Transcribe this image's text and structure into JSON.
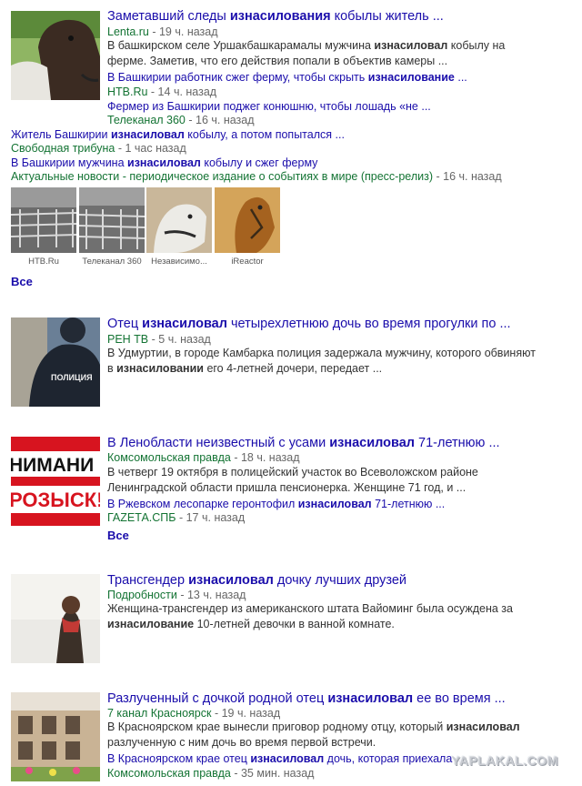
{
  "r1": {
    "title": [
      "Заметавший следы ",
      "изнасилования",
      " кобылы житель ..."
    ],
    "source": "Lenta.ru",
    "time": " - 19 ч. назад",
    "snippet1": [
      "В башкирском селе Уршакбашкарамалы мужчина ",
      "изнасиловал",
      " кобылу на"
    ],
    "snippet2": "ферме. Заметив, что его действия попали в объектив камеры ...",
    "rel1": {
      "title": [
        "В Башкирии работник сжег ферму, чтобы скрыть ",
        "изнасилование",
        " ..."
      ],
      "source": "НТВ.Ru",
      "time": " - 14 ч. назад"
    },
    "rel2": {
      "title": [
        "Фермер из Башкирии поджег конюшню, чтобы лошадь «не ..."
      ],
      "source": "Телеканал 360",
      "time": " - 16 ч. назад"
    },
    "rel3": {
      "title": [
        "Житель Башкирии ",
        "изнасиловал",
        " кобылу, а потом попытался ..."
      ],
      "source": "Свободная трибуна",
      "time": " - 1 час назад"
    },
    "rel4": {
      "title": [
        "В Башкирии мужчина ",
        "изнасиловал",
        " кобылу и сжег ферму"
      ],
      "source": "Актуальные новости - периодическое издание о событиях в мире (пресс-релиз)",
      "time": " - 16 ч. назад"
    },
    "gallery": [
      "HTB.Ru",
      "Телеканал 360",
      "Независимо...",
      "iReactor"
    ],
    "all": "Все"
  },
  "r2": {
    "title": [
      "Отец ",
      "изнасиловал",
      " четырехлетнюю дочь во время прогулки по ..."
    ],
    "source": "РЕН ТВ",
    "time": " - 5 ч. назад",
    "snippet1": [
      "В Удмуртии, в городе Камбарка полиция задержала мужчину, которого обвиняют"
    ],
    "snippet2": [
      "в ",
      "изнасиловании",
      " его 4-летней дочери, передает ..."
    ],
    "thumb_text": "ПОЛИЦИЯ"
  },
  "r3": {
    "title": [
      "В Ленобласти неизвестный с усами ",
      "изнасиловал",
      " 71-летнюю ..."
    ],
    "source": "Комсомольская правда",
    "time": " - 18 ч. назад",
    "snippet1": "В четверг 19 октября в полицейский участок во Всеволожском районе",
    "snippet2": "Ленинградской области пришла пенсионерка. Женщине 71 год, и ...",
    "rel1": {
      "title": [
        "В Ржевском лесопарке геронтофил ",
        "изнасиловал",
        " 71-летнюю ..."
      ],
      "source": "ГАZЕТА.СПБ",
      "time": " - 17 ч. назад"
    },
    "thumb_line1": "НИМАНИ",
    "thumb_line2": "РОЗЫСК!",
    "all": "Все"
  },
  "r4": {
    "title": [
      "Трансгендер ",
      "изнасиловал",
      " дочку лучших друзей"
    ],
    "source": "Подробности",
    "time": " - 13 ч. назад",
    "snippet1": "Женщина-трансгендер из американского штата Вайоминг была осуждена за",
    "snippet2": [
      "",
      "изнасилование",
      " 10-летней девочки в ванной комнате."
    ]
  },
  "r5": {
    "title": [
      "Разлученный с дочкой родной отец ",
      "изнасиловал",
      " ее во время ..."
    ],
    "source": "7 канал Красноярск",
    "time": " - 19 ч. назад",
    "snippet1": [
      "В Красноярском крае вынесли приговор родному отцу, который ",
      "изнасиловал"
    ],
    "snippet2": "разлученную с ним дочь во время первой встречи.",
    "rel1": {
      "title": [
        "В Красноярском крае отец ",
        "изнасиловал",
        " дочь, которая приехала ..."
      ],
      "source": "Комсомольская правда",
      "time": " - 35 мин. назад"
    }
  },
  "watermark": "YAPLAKAL.COM"
}
